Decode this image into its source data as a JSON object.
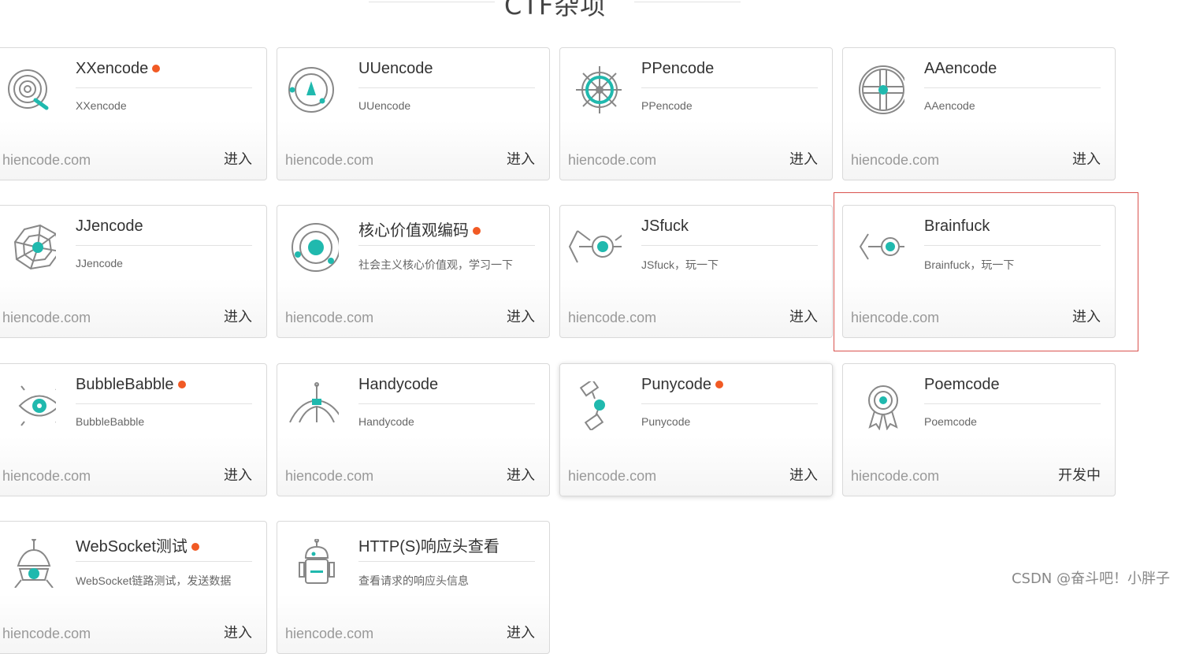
{
  "section": {
    "title": "CTF杂项"
  },
  "cards": [
    {
      "title": "XXencode",
      "dot": true,
      "desc": "XXencode",
      "site": "hiencode.com",
      "action": "进入",
      "icon": "spiral-icon"
    },
    {
      "title": "UUencode",
      "dot": false,
      "desc": "UUencode",
      "site": "hiencode.com",
      "action": "进入",
      "icon": "compass-icon"
    },
    {
      "title": "PPencode",
      "dot": false,
      "desc": "PPencode",
      "site": "hiencode.com",
      "action": "进入",
      "icon": "ship-wheel-icon"
    },
    {
      "title": "AAencode",
      "dot": false,
      "desc": "AAencode",
      "site": "hiencode.com",
      "action": "进入",
      "icon": "crosshair-icon"
    },
    {
      "title": "JJencode",
      "dot": false,
      "desc": "JJencode",
      "site": "hiencode.com",
      "action": "进入",
      "icon": "web-icon"
    },
    {
      "title": "核心价值观编码",
      "dot": true,
      "desc": "社会主义核心价值观，学习一下",
      "site": "hiencode.com",
      "action": "进入",
      "icon": "orbit-icon"
    },
    {
      "title": "JSfuck",
      "dot": false,
      "desc": "JSfuck，玩一下",
      "site": "hiencode.com",
      "action": "进入",
      "icon": "tie-fighter-icon"
    },
    {
      "title": "Brainfuck",
      "dot": false,
      "desc": "Brainfuck，玩一下",
      "site": "hiencode.com",
      "action": "进入",
      "icon": "tie-fighter-icon"
    },
    {
      "title": "BubbleBabble",
      "dot": true,
      "desc": "BubbleBabble",
      "site": "hiencode.com",
      "action": "进入",
      "icon": "eye-icon"
    },
    {
      "title": "Handycode",
      "dot": false,
      "desc": "Handycode",
      "site": "hiencode.com",
      "action": "进入",
      "icon": "lander-icon"
    },
    {
      "title": "Punycode",
      "dot": true,
      "desc": "Punycode",
      "site": "hiencode.com",
      "action": "进入",
      "icon": "satellite-icon"
    },
    {
      "title": "Poemcode",
      "dot": false,
      "desc": "Poemcode",
      "site": "hiencode.com",
      "action": "开发中",
      "icon": "medal-icon"
    },
    {
      "title": "WebSocket测试",
      "dot": true,
      "desc": "WebSocket链路测试，发送数据",
      "site": "hiencode.com",
      "action": "进入",
      "icon": "capsule-icon"
    },
    {
      "title": "HTTP(S)响应头查看",
      "dot": false,
      "desc": "查看请求的响应头信息",
      "site": "hiencode.com",
      "action": "进入",
      "icon": "robot-icon"
    }
  ],
  "watermark": "CSDN @奋斗吧！小胖子",
  "colors": {
    "accent": "#20b9ae",
    "dot": "#f15a24",
    "highlight": "#d9534f"
  }
}
